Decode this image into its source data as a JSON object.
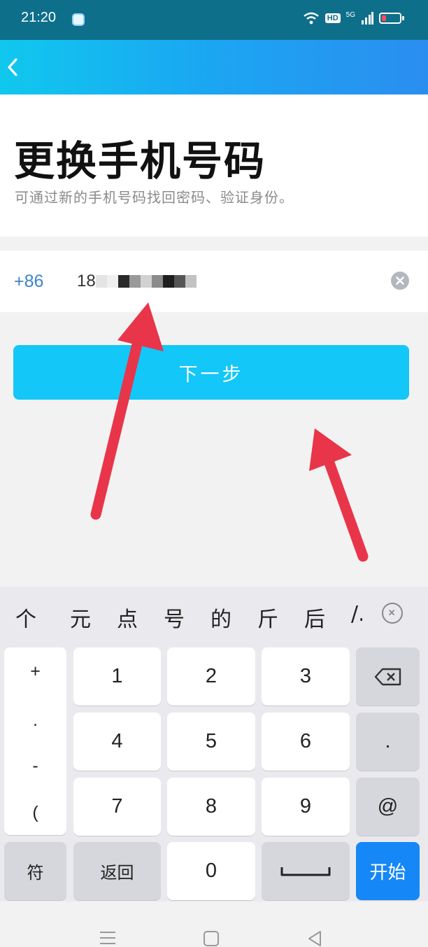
{
  "status_bar": {
    "time": "21:20",
    "hd": "HD",
    "net": "5G",
    "battery_level": 0.25,
    "battery_color": "#ff4b5c"
  },
  "header": {
    "back_icon": "chevron-left-icon",
    "gradient": [
      "#10c8ee",
      "#2a8ef0"
    ]
  },
  "title_section": {
    "title": "更换手机号码",
    "subtitle": "可通过新的手机号码找回密码、验证身份。"
  },
  "phone_input": {
    "country_code": "+86",
    "value": "18",
    "clear_icon": "clear-icon",
    "accent": "#3d83c9"
  },
  "next_button": {
    "label": "下一步",
    "color": "#13c7f8"
  },
  "keyboard": {
    "candidates": [
      "个",
      "元",
      "点",
      "号",
      "的",
      "斤",
      "后",
      "/."
    ],
    "symbols": [
      "+",
      ".",
      "-",
      "("
    ],
    "digits": [
      "1",
      "2",
      "3",
      "4",
      "5",
      "6",
      "7",
      "8",
      "9",
      "0"
    ],
    "right_keys": {
      "dot": ".",
      "at": "@"
    },
    "bottom": {
      "symbols": "符",
      "back": "返回",
      "go": "开始"
    },
    "go_color": "#1687f7"
  },
  "annotation_arrow_color": "#e8354a"
}
